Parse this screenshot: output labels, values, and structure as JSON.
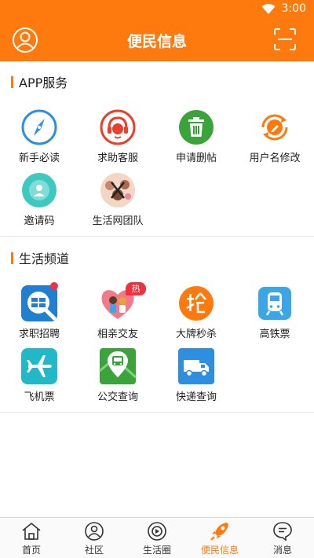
{
  "status_bar": {
    "time": "3:00",
    "wifi_icon": "wifi-icon"
  },
  "header": {
    "title": "便民信息",
    "left_icon": "user-avatar-icon",
    "right_icon": "scan-icon"
  },
  "sections": [
    {
      "title": "APP服务",
      "items": [
        {
          "label": "新手必读",
          "icon": "compass-icon",
          "color": "#2e8ee0"
        },
        {
          "label": "求助客服",
          "icon": "customer-service-icon",
          "color": "#e8402a"
        },
        {
          "label": "申请删帖",
          "icon": "trash-icon",
          "color": "#3aa43a"
        },
        {
          "label": "用户名修改",
          "icon": "refresh-edit-icon",
          "color": "#ff7a0e"
        },
        {
          "label": "邀请码",
          "icon": "invite-code-icon",
          "color": "#3ec9c0"
        },
        {
          "label": "生活网团队",
          "icon": "team-photo-icon",
          "color": "#c48a6a"
        }
      ]
    },
    {
      "title": "生活频道",
      "items": [
        {
          "label": "求职招聘",
          "icon": "job-search-icon",
          "color": "#1f7fd0",
          "badge": "dot"
        },
        {
          "label": "相亲交友",
          "icon": "heart-couple-icon",
          "color": "#f07a8a",
          "badge": "热"
        },
        {
          "label": "大牌秒杀",
          "icon": "flash-sale-icon",
          "color": "#ff7a0e"
        },
        {
          "label": "高铁票",
          "icon": "train-icon",
          "color": "#3aa6e8"
        },
        {
          "label": "飞机票",
          "icon": "airplane-icon",
          "color": "#22b8c8"
        },
        {
          "label": "公交查询",
          "icon": "bus-map-icon",
          "color": "#3aa43a"
        },
        {
          "label": "快递查询",
          "icon": "delivery-truck-icon",
          "color": "#2e8ee0"
        }
      ]
    }
  ],
  "tabs": [
    {
      "label": "首页",
      "icon": "home-icon",
      "active": false
    },
    {
      "label": "社区",
      "icon": "community-icon",
      "active": false
    },
    {
      "label": "生活圈",
      "icon": "life-circle-icon",
      "active": false
    },
    {
      "label": "便民信息",
      "icon": "rocket-icon",
      "active": true
    },
    {
      "label": "消息",
      "icon": "message-icon",
      "active": false
    }
  ],
  "colors": {
    "accent": "#ff7a0e",
    "divider": "#e8e8e8",
    "tab_bg": "#fafafa"
  }
}
